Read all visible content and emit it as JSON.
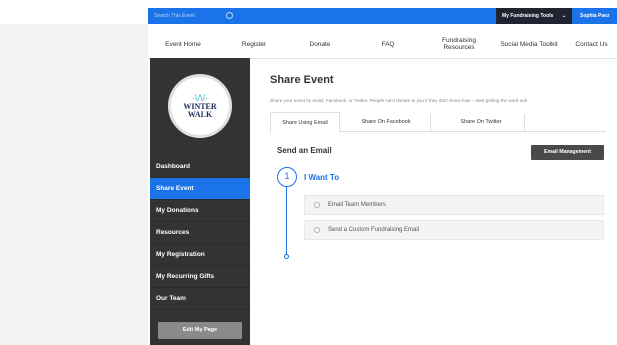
{
  "topbar": {
    "search_placeholder": "Search This Event",
    "tools_label": "My Fundraising Tools",
    "tools_caret": "⌄",
    "user_name": "Sophia Paez",
    "accent_color": "#1a73e8"
  },
  "nav": {
    "items": [
      {
        "label": "Event Home"
      },
      {
        "label": "Register"
      },
      {
        "label": "Donate"
      },
      {
        "label": "FAQ"
      },
      {
        "label": "Fundraising Resources"
      },
      {
        "label": "Social Media Toolkit"
      },
      {
        "label": "Contact Us"
      }
    ]
  },
  "sidebar": {
    "logo": {
      "flake": "·\\/\\/·",
      "line1": "WINTER",
      "line2": "WALK"
    },
    "items": [
      {
        "label": "Dashboard",
        "active": false
      },
      {
        "label": "Share Event",
        "active": true
      },
      {
        "label": "My Donations",
        "active": false
      },
      {
        "label": "Resources",
        "active": false
      },
      {
        "label": "My Registration",
        "active": false
      },
      {
        "label": "My Recurring Gifts",
        "active": false
      },
      {
        "label": "Our Team",
        "active": false
      }
    ],
    "edit_button": "Edit My Page"
  },
  "main": {
    "title": "Share Event",
    "description": "Share your event by email, Facebook, or Twitter. People can't donate to you if they don't know how – start getting the word out!",
    "tabs": [
      {
        "label": "Share Using Email",
        "active": true
      },
      {
        "label": "Share On Facebook",
        "active": false
      },
      {
        "label": "Share On Twitter",
        "active": false
      }
    ],
    "section_title": "Send an Email",
    "email_management_button": "Email Management",
    "step": {
      "number": "1",
      "title": "I Want To",
      "options": [
        {
          "label": "Email Team Members"
        },
        {
          "label": "Send a Custom Fundraising Email"
        }
      ]
    }
  }
}
